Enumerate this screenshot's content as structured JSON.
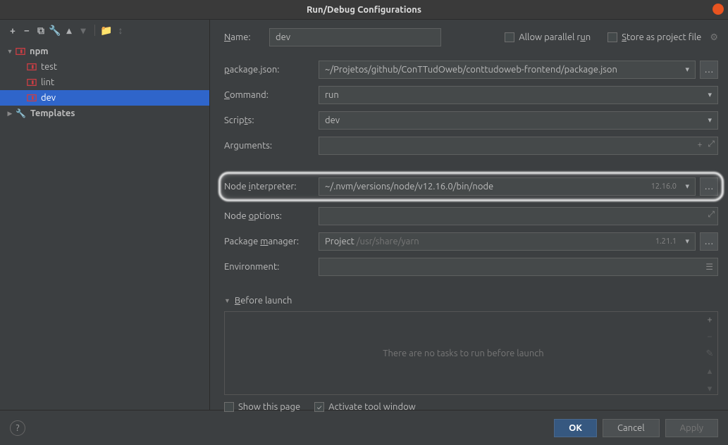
{
  "title": "Run/Debug Configurations",
  "tree": {
    "npm": "npm",
    "items": [
      "test",
      "lint",
      "dev"
    ],
    "templates": "Templates"
  },
  "form": {
    "name_label": "Name:",
    "name_value": "dev",
    "allow_parallel": "Allow parallel run",
    "store_project": "Store as project file",
    "package_label": "package.json:",
    "package_value": "~/Projetos/github/ConTTudOweb/conttudoweb-frontend/package.json",
    "command_label": "Command:",
    "command_value": "run",
    "scripts_label": "Scripts:",
    "scripts_value": "dev",
    "arguments_label": "Arguments:",
    "node_interp_label": "Node interpreter:",
    "node_interp_value": "~/.nvm/versions/node/v12.16.0/bin/node",
    "node_interp_version": "12.16.0",
    "node_options_label": "Node options:",
    "pkg_mgr_label": "Package manager:",
    "pkg_mgr_prefix": "Project",
    "pkg_mgr_path": "/usr/share/yarn",
    "pkg_mgr_version": "1.21.1",
    "env_label": "Environment:",
    "before_launch": "Before launch",
    "before_launch_empty": "There are no tasks to run before launch",
    "show_page": "Show this page",
    "activate_tool": "Activate tool window"
  },
  "footer": {
    "ok": "OK",
    "cancel": "Cancel",
    "apply": "Apply"
  }
}
